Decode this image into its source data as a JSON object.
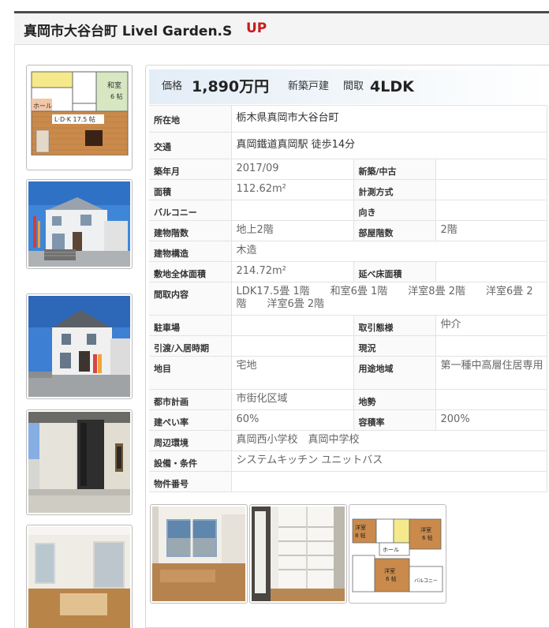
{
  "header": {
    "title": "真岡市大谷台町 Livel Garden.S",
    "badge": "UP"
  },
  "price_bar": {
    "price_label": "価格",
    "price_value": "1,890万円",
    "type": "新築戸建",
    "layout_label": "間取",
    "layout_value": "4LDK"
  },
  "address": {
    "label": "所在地",
    "value": "栃木県真岡市大谷台町"
  },
  "transport": {
    "label": "交通",
    "value": "真岡鐵道真岡駅 徒歩14分"
  },
  "specs": {
    "built": {
      "label": "築年月",
      "value": "2017/09"
    },
    "new_used": {
      "label": "新築/中古",
      "value": ""
    },
    "area": {
      "label": "面積",
      "value": "112.62m²"
    },
    "measure": {
      "label": "計測方式",
      "value": ""
    },
    "balcony": {
      "label": "バルコニー",
      "value": ""
    },
    "direction": {
      "label": "向き",
      "value": ""
    },
    "floors": {
      "label": "建物階数",
      "value": "地上2階"
    },
    "room_floor": {
      "label": "部屋階数",
      "value": "2階"
    },
    "structure": {
      "label": "建物構造",
      "value": "木造"
    },
    "land_area": {
      "label": "敷地全体面積",
      "value": "214.72m²"
    },
    "total_floor": {
      "label": "延べ床面積",
      "value": ""
    },
    "rooms": {
      "label": "間取内容",
      "value": "LDK17.5畳 1階　　和室6畳 1階　　洋室8畳 2階　　洋室6畳 2階　　洋室6畳 2階"
    },
    "parking": {
      "label": "駐車場",
      "value": ""
    },
    "transaction": {
      "label": "取引態様",
      "value": "仲介"
    },
    "handover": {
      "label": "引渡/入居時期",
      "value": ""
    },
    "status": {
      "label": "現況",
      "value": ""
    },
    "land_category": {
      "label": "地目",
      "value": "宅地"
    },
    "zoning": {
      "label": "用途地域",
      "value": "第一種中高層住居専用"
    },
    "city_plan": {
      "label": "都市計画",
      "value": "市街化区域"
    },
    "terrain": {
      "label": "地勢",
      "value": ""
    },
    "coverage": {
      "label": "建ぺい率",
      "value": "60%"
    },
    "far": {
      "label": "容積率",
      "value": "200%"
    },
    "surroundings": {
      "label": "周辺環境",
      "value": "真岡西小学校　真岡中学校"
    },
    "equipment": {
      "label": "設備・条件",
      "value": "システムキッチン ユニットバス"
    },
    "property_no": {
      "label": "物件番号",
      "value": ""
    }
  },
  "thumbnails": [
    "floorplan-1f",
    "exterior-front",
    "exterior-side",
    "entrance",
    "living-room"
  ],
  "gallery": [
    "room-interior",
    "closet",
    "floorplan-2f"
  ],
  "floorplan_labels": {
    "ldk": "L·D·K 17.5 帖",
    "washitsu": "和室",
    "washitsu_size": "6 帖",
    "hall": "ホール",
    "yoshitsu": "洋室",
    "yoshitsu_size_8": "8 帖",
    "yoshitsu_size_6": "6 帖",
    "balcony": "バルコニー"
  },
  "colors": {
    "accent_red": "#c81b1b",
    "price_bar_start": "#e3edf6",
    "floor_wood": "#c98a4b"
  }
}
